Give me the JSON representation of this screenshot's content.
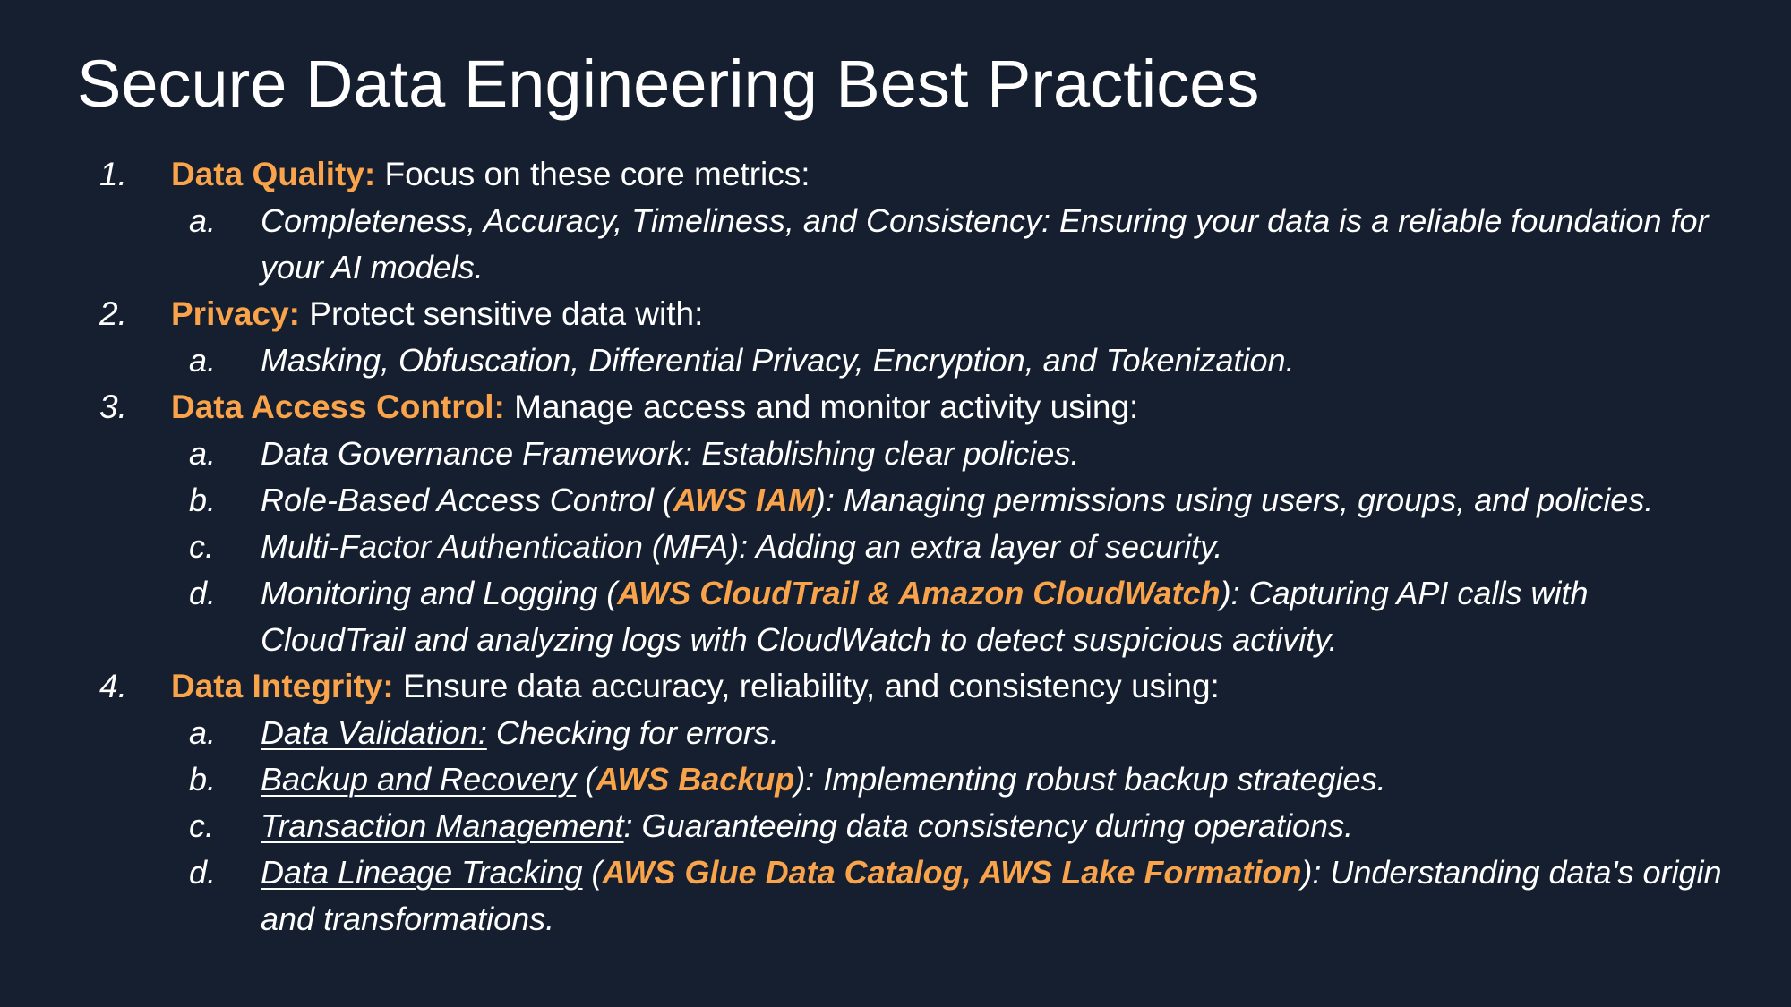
{
  "title": "Secure Data Engineering Best Practices",
  "items": [
    {
      "num": "1.",
      "head": "Data Quality:",
      "rest": " Focus on these core metrics:",
      "subs": [
        {
          "letter": "a.",
          "text": "Completeness, Accuracy, Timeliness, and Consistency: Ensuring your data is a reliable foundation for your AI models."
        }
      ]
    },
    {
      "num": "2.",
      "head": "Privacy:",
      "rest": " Protect sensitive data with:",
      "subs": [
        {
          "letter": "a.",
          "text": "Masking, Obfuscation, Differential Privacy, Encryption, and Tokenization."
        }
      ]
    },
    {
      "num": "3.",
      "head": "Data Access Control:",
      "rest": " Manage access and monitor activity using:",
      "subs": [
        {
          "letter": "a.",
          "text": "Data Governance Framework: Establishing clear policies."
        },
        {
          "letter": "b.",
          "pre": "Role-Based Access Control (",
          "hl": "AWS IAM",
          "post": "): Managing permissions using users, groups, and policies."
        },
        {
          "letter": "c.",
          "text": "Multi-Factor Authentication (MFA): Adding an extra layer of security."
        },
        {
          "letter": "d.",
          "pre": "Monitoring and Logging (",
          "hl": "AWS CloudTrail & Amazon CloudWatch",
          "post": "): Capturing API calls with CloudTrail and analyzing logs with CloudWatch to detect suspicious activity."
        }
      ]
    },
    {
      "num": "4.",
      "head": "Data Integrity:",
      "rest": " Ensure data accuracy, reliability, and consistency using:",
      "subs": [
        {
          "letter": "a.",
          "u": "Data Validation:",
          "post": " Checking for errors."
        },
        {
          "letter": "b.",
          "u": "Backup and Recovery",
          "pre2": " (",
          "hl": "AWS Backup",
          "post": "): Implementing robust backup strategies."
        },
        {
          "letter": "c.",
          "u": "Transaction Management",
          "post": ": Guaranteeing data consistency during operations."
        },
        {
          "letter": "d.",
          "u": "Data Lineage Tracking",
          "pre2": " (",
          "hl": "AWS Glue Data Catalog, AWS Lake Formation",
          "post": "): Understanding data's origin and transformations."
        }
      ]
    }
  ],
  "colors": {
    "background": "#151f2f",
    "accent": "#f9a34a",
    "text": "#ffffff"
  }
}
